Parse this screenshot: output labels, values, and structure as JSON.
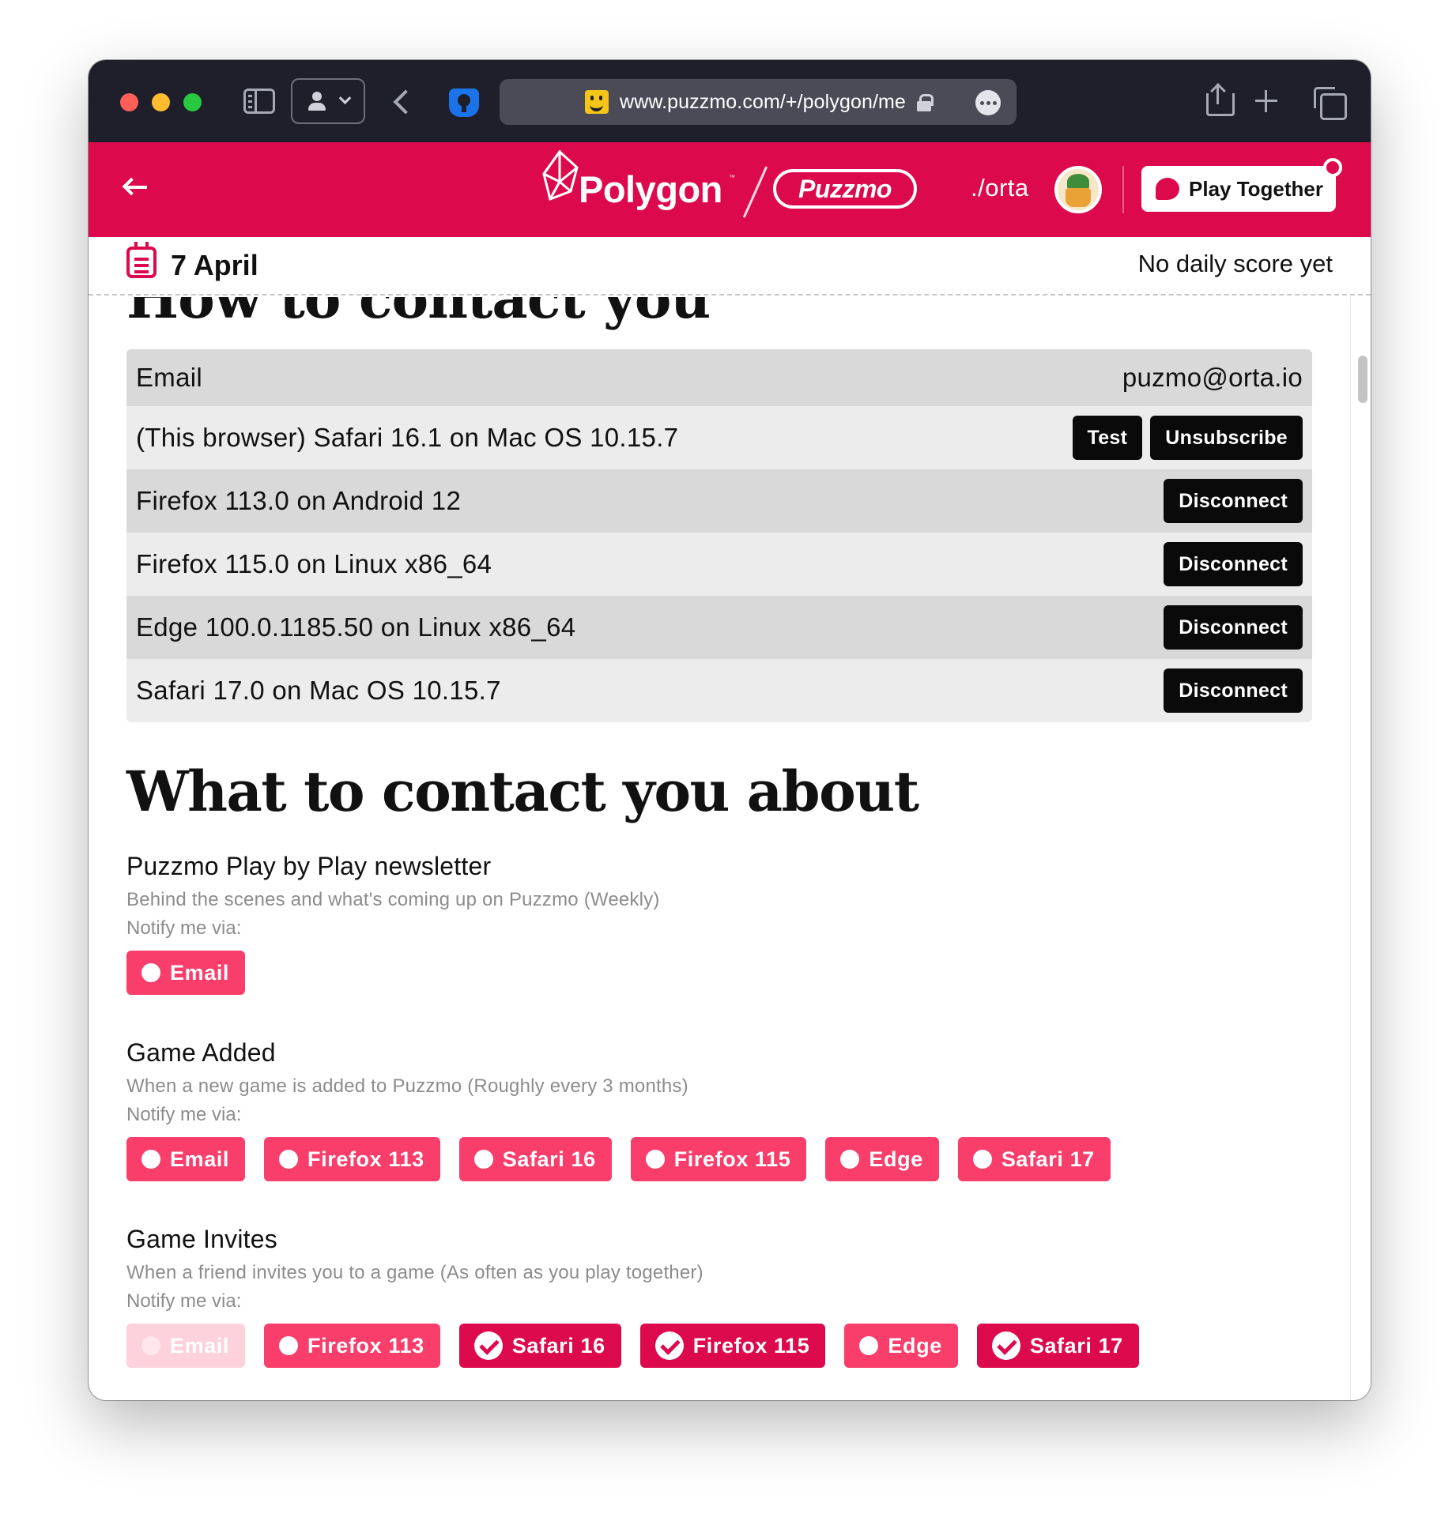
{
  "browser": {
    "url": "www.puzzmo.com/+/polygon/me"
  },
  "header": {
    "brand": "Polygon",
    "brand_tm": "™",
    "partner": "Puzzmo",
    "user": "./orta",
    "play_together": "Play Together"
  },
  "date_bar": {
    "date": "7 April",
    "score": "No daily score yet"
  },
  "how_section": {
    "title": "How to contact you",
    "email_row": {
      "label": "Email",
      "value": "puzmo@orta.io"
    },
    "devices": [
      {
        "name": "(This browser) Safari 16.1 on Mac OS 10.15.7",
        "buttons": [
          "Test",
          "Unsubscribe"
        ]
      },
      {
        "name": "Firefox 113.0 on Android 12",
        "buttons": [
          "Disconnect"
        ]
      },
      {
        "name": "Firefox 115.0 on Linux x86_64",
        "buttons": [
          "Disconnect"
        ]
      },
      {
        "name": "Edge 100.0.1185.50 on Linux x86_64",
        "buttons": [
          "Disconnect"
        ]
      },
      {
        "name": "Safari 17.0 on Mac OS 10.15.7",
        "buttons": [
          "Disconnect"
        ]
      }
    ]
  },
  "what_section": {
    "title": "What to contact you about",
    "notify_label": "Notify me via:",
    "topics": [
      {
        "title": "Puzzmo Play by Play newsletter",
        "description": "Behind the scenes and what's coming up on Puzzmo (Weekly)",
        "channels": [
          {
            "label": "Email",
            "state": "off"
          }
        ]
      },
      {
        "title": "Game Added",
        "description": "When a new game is added to Puzzmo (Roughly every 3 months)",
        "channels": [
          {
            "label": "Email",
            "state": "off"
          },
          {
            "label": "Firefox 113",
            "state": "off"
          },
          {
            "label": "Safari 16",
            "state": "off"
          },
          {
            "label": "Firefox 115",
            "state": "off"
          },
          {
            "label": "Edge",
            "state": "off"
          },
          {
            "label": "Safari 17",
            "state": "off"
          }
        ]
      },
      {
        "title": "Game Invites",
        "description": "When a friend invites you to a game (As often as you play together)",
        "channels": [
          {
            "label": "Email",
            "state": "disabled"
          },
          {
            "label": "Firefox 113",
            "state": "off"
          },
          {
            "label": "Safari 16",
            "state": "on"
          },
          {
            "label": "Firefox 115",
            "state": "on"
          },
          {
            "label": "Edge",
            "state": "off"
          },
          {
            "label": "Safari 17",
            "state": "on"
          }
        ]
      }
    ]
  },
  "colors": {
    "brand": "#dc0a4d",
    "chip_off": "#fa3e6b",
    "chip_disabled": "#fdd2dc",
    "chrome": "#1e1f2b"
  }
}
